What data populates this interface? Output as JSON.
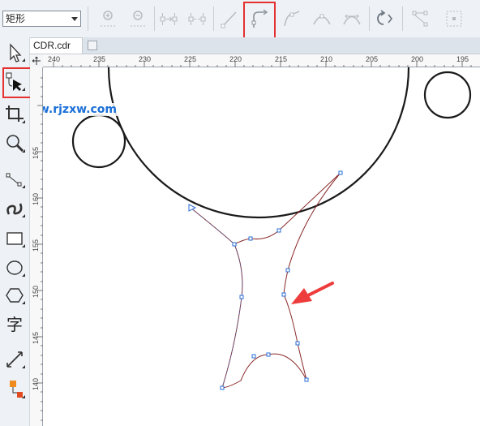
{
  "toolbar": {
    "shape_select_value": "矩形",
    "buttons": [
      "add-node",
      "delete-node",
      "join-nodes",
      "break-curve",
      "to-line",
      "to-curve",
      "cusp-node",
      "smooth-node",
      "symmetrical-node",
      "reverse-direction",
      "extend-curve-to-close",
      "extract-subpath"
    ]
  },
  "document": {
    "tab_label": "CDR.cdr"
  },
  "rulers": {
    "horizontal": [
      "240",
      "235",
      "230",
      "225",
      "220",
      "215",
      "210",
      "205",
      "200",
      "195"
    ],
    "vertical": [
      "165",
      "160",
      "155",
      "150",
      "145",
      "140"
    ]
  },
  "toolbox": {
    "tools": [
      "pick-tool",
      "shape-tool",
      "crop-tool",
      "zoom-tool",
      "freehand-tool",
      "artistic-media-tool",
      "rectangle-tool",
      "ellipse-tool",
      "polygon-tool",
      "text-tool",
      "parallel-dimension-tool",
      "interactive-fill-tool"
    ],
    "text_tool_glyph": "字"
  },
  "watermark": "www.rjzxw.com",
  "colors": {
    "highlight": "#e53030",
    "arrow": "#ee3b3b",
    "node": "#2a6fd6",
    "watermark": "#1a6fd8"
  }
}
